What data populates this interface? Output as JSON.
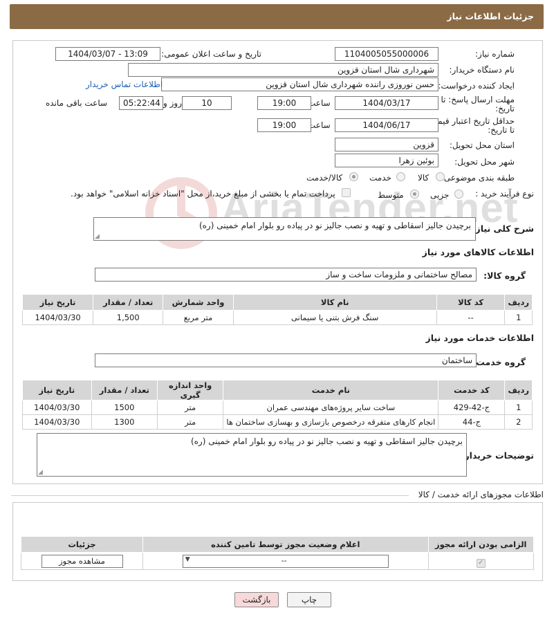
{
  "header": {
    "title": "جزئیات اطلاعات نیاز"
  },
  "fields": {
    "need_number_label": "شماره نیاز:",
    "need_number": "1104005055000006",
    "announce_label": "تاریخ و ساعت اعلان عمومی:",
    "announce_value": "1404/03/07 - 13:09",
    "buyer_org_label": "نام دستگاه خریدار:",
    "buyer_org": "شهرداری شال استان قزوین",
    "creator_label": "ایجاد کننده درخواست:",
    "creator": "حسن نوروزی راننده شهرداری شال استان قزوین",
    "contact_link": "اطلاعات تماس خریدار",
    "deadline_label_1": "مهلت ارسال پاسخ: تا",
    "deadline_label_2": "تاریخ:",
    "deadline_date": "1404/03/17",
    "time_label": "ساعت",
    "deadline_time": "19:00",
    "days_value": "10",
    "days_label": "روز و",
    "remaining_value": "05:22:44",
    "remaining_label": "ساعت باقی مانده",
    "validity_label_1": "حداقل تاریخ اعتبار قیمت:",
    "validity_label_2": "تا تاریخ:",
    "validity_date": "1404/06/17",
    "validity_time": "19:00",
    "province_label": "استان محل تحویل:",
    "province": "قزوین",
    "city_label": "شهر محل تحویل:",
    "city": "بوئین زهرا",
    "category_label": "طبقه بندی موضوعی:",
    "category_options": [
      "کالا",
      "خدمت",
      "کالا/خدمت"
    ],
    "process_label": "نوع فرآیند خرید :",
    "process_options": [
      "جزیی",
      "متوسط"
    ],
    "payment_note": "پرداخت تمام یا بخشی از مبلغ خرید،از محل \"اسناد خزانه اسلامی\" خواهد بود."
  },
  "description": {
    "label": "شرح کلی نیاز:",
    "text": "برچیدن جالیز اسقاطی و تهیه و نصب جالیز نو در پیاده رو بلوار امام خمینی (ره)"
  },
  "goods": {
    "section_title": "اطلاعات کالاهای مورد نیاز",
    "group_label": "گروه کالا:",
    "group_value": "مصالح ساختمانی و ملزومات ساخت و ساز",
    "columns": [
      "ردیف",
      "کد کالا",
      "نام کالا",
      "واحد شمارش",
      "تعداد / مقدار",
      "تاریخ نیاز"
    ],
    "rows": [
      [
        "1",
        "--",
        "سنگ فرش بتنی یا سیمانی",
        "متر مربع",
        "1,500",
        "1404/03/30"
      ]
    ]
  },
  "services": {
    "section_title": "اطلاعات خدمات مورد نیاز",
    "group_label": "گروه خدمت:",
    "group_value": "ساختمان",
    "columns": [
      "ردیف",
      "کد خدمت",
      "نام خدمت",
      "واحد اندازه گیری",
      "تعداد / مقدار",
      "تاریخ نیاز"
    ],
    "rows": [
      [
        "1",
        "ج-42-429",
        "ساخت سایر پروژه‌های مهندسی عمران",
        "متر",
        "1500",
        "1404/03/30"
      ],
      [
        "2",
        "ج-44",
        "انجام کارهای متفرقه درخصوص بازسازی و بهسازی ساختمان ها",
        "متر",
        "1300",
        "1404/03/30"
      ]
    ]
  },
  "buyer_notes": {
    "label": "توضیحات خریدار:",
    "text": "برچیدن جالیز اسقاطی و تهیه و نصب جالیز نو در پیاده رو بلوار امام خمینی (ره)"
  },
  "permits": {
    "title": "اطلاعات مجوزهای ارائه خدمت / کالا",
    "columns": [
      "الزامی بودن ارائه مجوز",
      "اعلام وضعیت مجوز توسط تامین کننده",
      "جزئیات"
    ],
    "select_value": "--",
    "view_button": "مشاهده مجوز"
  },
  "buttons": {
    "print": "چاپ",
    "back": "بازگشت"
  },
  "watermark": "AriaTender.net",
  "colors": {
    "header_bg": "#8b6b45",
    "link": "#1a5fb4",
    "table_header": "#d6d6d6",
    "back_button": "#f7d9d9"
  }
}
